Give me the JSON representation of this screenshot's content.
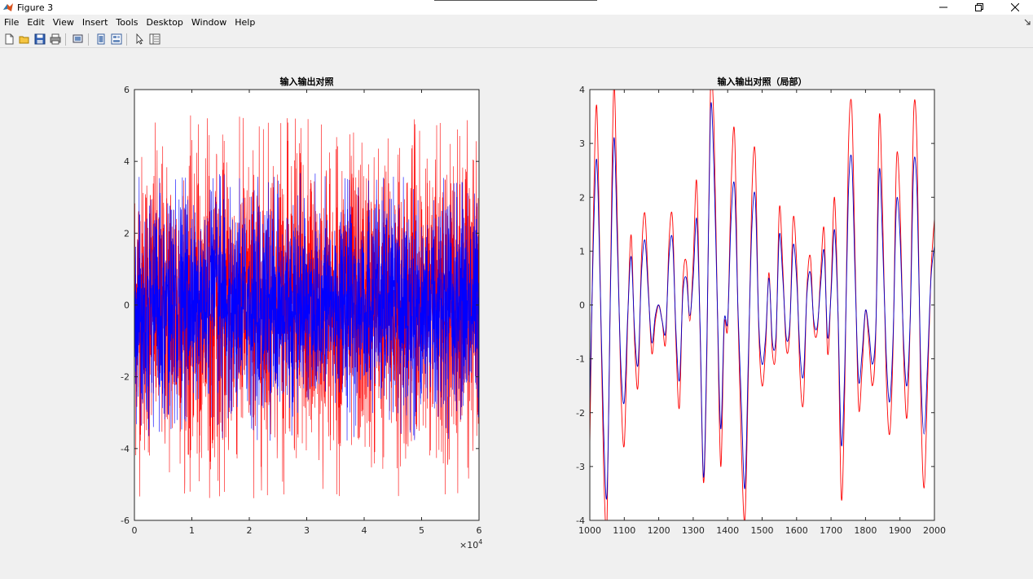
{
  "window": {
    "title": "Figure 3"
  },
  "menu": [
    "File",
    "Edit",
    "View",
    "Insert",
    "Tools",
    "Desktop",
    "Window",
    "Help"
  ],
  "toolbar": {
    "buttons": [
      "new-figure-icon",
      "open-file-icon",
      "save-icon",
      "print-icon",
      "print-preview-icon",
      "link-plot-icon",
      "insert-colorbar-icon",
      "edit-plot-arrow-icon",
      "property-inspector-icon"
    ]
  },
  "colors": {
    "input_series": "#ff0000",
    "output_series_left": "#0000ff",
    "output_series_right": "#0000c8"
  },
  "chart_data": [
    {
      "type": "line",
      "title": "输入输出对照",
      "xlabel": "",
      "ylabel": "",
      "xlim": [
        0,
        60000
      ],
      "ylim": [
        -6,
        6
      ],
      "x_ticks": [
        0,
        10000,
        20000,
        30000,
        40000,
        50000,
        60000
      ],
      "x_tick_labels": [
        "0",
        "1",
        "2",
        "3",
        "4",
        "5",
        "6"
      ],
      "x_exponent_label": "×10",
      "x_exponent_power": "4",
      "y_ticks": [
        -6,
        -4,
        -2,
        0,
        2,
        4,
        6
      ],
      "y_tick_labels": [
        "-6",
        "-4",
        "-2",
        "0",
        "2",
        "4",
        "6"
      ],
      "grid": false,
      "series": [
        {
          "color": "#ff0000",
          "approx_envelope": [
            -5.4,
            5.3
          ]
        },
        {
          "color": "#0000ff",
          "approx_envelope": [
            -3.8,
            3.7
          ]
        }
      ]
    },
    {
      "type": "line",
      "title": "输入输出对照（局部）",
      "xlabel": "",
      "ylabel": "",
      "xlim": [
        1000,
        2000
      ],
      "ylim": [
        -4,
        4
      ],
      "x_ticks": [
        1000,
        1100,
        1200,
        1300,
        1400,
        1500,
        1600,
        1700,
        1800,
        1900,
        2000
      ],
      "x_tick_labels": [
        "1000",
        "1100",
        "1200",
        "1300",
        "1400",
        "1500",
        "1600",
        "1700",
        "1800",
        "1900",
        "2000"
      ],
      "y_ticks": [
        -4,
        -3,
        -2,
        -1,
        0,
        1,
        2,
        3,
        4
      ],
      "y_tick_labels": [
        "-4",
        "-3",
        "-2",
        "-1",
        "0",
        "1",
        "2",
        "3",
        "4"
      ],
      "grid": false,
      "series": [
        {
          "color": "#ff0000",
          "x": [
            1000,
            1010,
            1020,
            1030,
            1040,
            1050,
            1060,
            1070,
            1080,
            1090,
            1100,
            1110,
            1120,
            1130,
            1140,
            1150,
            1160,
            1170,
            1180,
            1190,
            1200,
            1210,
            1220,
            1230,
            1240,
            1250,
            1260,
            1270,
            1280,
            1290,
            1300,
            1310,
            1320,
            1330,
            1340,
            1350,
            1360,
            1370,
            1380,
            1390,
            1400,
            1410,
            1420,
            1430,
            1440,
            1450,
            1460,
            1470,
            1480,
            1490,
            1500,
            1510,
            1520,
            1530,
            1540,
            1550,
            1560,
            1570,
            1580,
            1590,
            1600,
            1610,
            1620,
            1630,
            1640,
            1650,
            1660,
            1670,
            1680,
            1690,
            1700,
            1710,
            1720,
            1730,
            1740,
            1750,
            1760,
            1770,
            1780,
            1790,
            1800,
            1810,
            1820,
            1830,
            1840,
            1850,
            1860,
            1870,
            1880,
            1890,
            1900,
            1910,
            1920,
            1930,
            1940,
            1950,
            1960,
            1970,
            1980,
            1990,
            2000
          ],
          "y": [
            -2.6,
            1.5,
            3.7,
            0.5,
            -3.0,
            -4.0,
            0.5,
            4.1,
            1.5,
            -1.5,
            -2.6,
            -0.3,
            1.3,
            -0.7,
            -1.5,
            0.9,
            1.7,
            0.3,
            -0.9,
            -0.3,
            0.0,
            -0.3,
            -0.7,
            1.2,
            1.6,
            -0.7,
            -1.9,
            0.4,
            0.8,
            -0.3,
            0.8,
            2.3,
            -0.5,
            -3.3,
            -0.8,
            4.0,
            3.4,
            0.0,
            -3.0,
            -0.4,
            -0.4,
            2.2,
            3.2,
            -0.2,
            -2.7,
            -4.0,
            -1.3,
            2.0,
            2.8,
            -0.4,
            -1.5,
            -0.8,
            0.6,
            -0.9,
            -0.8,
            1.8,
            0.7,
            -0.8,
            -0.5,
            1.6,
            0.8,
            -1.3,
            -1.8,
            0.3,
            0.9,
            -0.4,
            -0.5,
            0.6,
            1.4,
            -0.9,
            0.3,
            2.0,
            -0.1,
            -3.6,
            -1.5,
            2.8,
            3.7,
            0.8,
            -1.9,
            -1.2,
            -0.1,
            -0.7,
            -1.5,
            -0.5,
            3.5,
            1.6,
            -1.3,
            -2.4,
            -0.8,
            2.7,
            1.9,
            -0.8,
            -2.1,
            -0.2,
            3.6,
            2.8,
            -1.6,
            -3.4,
            -1.5,
            0.6,
            1.6
          ]
        },
        {
          "color": "#0000c8",
          "x": [
            1000,
            1010,
            1020,
            1030,
            1040,
            1050,
            1060,
            1070,
            1080,
            1090,
            1100,
            1110,
            1120,
            1130,
            1140,
            1150,
            1160,
            1170,
            1180,
            1190,
            1200,
            1210,
            1220,
            1230,
            1240,
            1250,
            1260,
            1270,
            1280,
            1290,
            1300,
            1310,
            1320,
            1330,
            1340,
            1350,
            1360,
            1370,
            1380,
            1390,
            1400,
            1410,
            1420,
            1430,
            1440,
            1450,
            1460,
            1470,
            1480,
            1490,
            1500,
            1510,
            1520,
            1530,
            1540,
            1550,
            1560,
            1570,
            1580,
            1590,
            1600,
            1610,
            1620,
            1630,
            1640,
            1650,
            1660,
            1670,
            1680,
            1690,
            1700,
            1710,
            1720,
            1730,
            1740,
            1750,
            1760,
            1770,
            1780,
            1790,
            1800,
            1810,
            1820,
            1830,
            1840,
            1850,
            1860,
            1870,
            1880,
            1890,
            1900,
            1910,
            1920,
            1930,
            1940,
            1950,
            1960,
            1970,
            1980,
            1990,
            2000
          ],
          "y": [
            -1.9,
            1.1,
            2.7,
            0.4,
            -2.3,
            -3.5,
            0.3,
            3.1,
            1.1,
            -1.1,
            -1.8,
            -0.2,
            0.9,
            -0.5,
            -1.1,
            0.6,
            1.2,
            0.2,
            -0.7,
            -0.2,
            0.0,
            -0.3,
            -0.5,
            0.9,
            1.2,
            -0.5,
            -1.4,
            0.2,
            0.5,
            -0.2,
            0.5,
            1.6,
            -0.4,
            -3.2,
            -0.6,
            3.6,
            2.6,
            0.0,
            -2.3,
            -0.3,
            -0.3,
            1.6,
            2.2,
            -0.1,
            -1.9,
            -3.4,
            -1.0,
            1.4,
            2.0,
            -0.3,
            -1.1,
            -0.6,
            0.5,
            -0.7,
            -0.6,
            1.3,
            0.5,
            -0.6,
            -0.4,
            1.1,
            0.5,
            -0.9,
            -1.3,
            0.2,
            0.6,
            -0.3,
            -0.4,
            0.4,
            1.0,
            -0.6,
            0.2,
            1.4,
            -0.1,
            -2.6,
            -1.1,
            2.0,
            2.7,
            0.5,
            -1.4,
            -0.9,
            -0.1,
            -0.5,
            -1.1,
            -0.4,
            2.5,
            1.1,
            -0.9,
            -1.8,
            -0.6,
            1.9,
            1.3,
            -0.6,
            -1.5,
            -0.2,
            2.6,
            2.0,
            -1.1,
            -2.4,
            -1.1,
            0.5,
            1.1
          ]
        }
      ]
    }
  ]
}
